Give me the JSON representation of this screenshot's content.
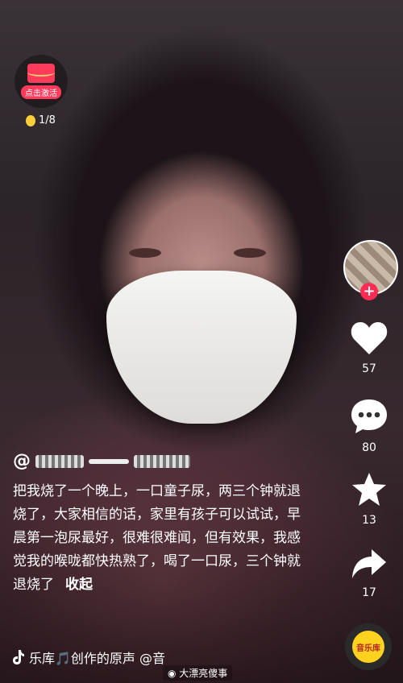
{
  "reward": {
    "label": "点击激活",
    "coins": "1/8"
  },
  "actions": {
    "likes": "57",
    "comments": "80",
    "favorites": "13",
    "shares": "17"
  },
  "post": {
    "username_prefix": "@",
    "caption": "把我烧了一个晚上，一口童子尿，两三个钟就退烧了，大家相信的话，家里有孩子可以试试，早晨第一泡尿最好，很难很难闻，但有效果，我感觉我的喉咙都快热熟了，喝了一口尿，三个钟就退烧了",
    "collapse": "收起"
  },
  "music": {
    "text": "乐库🎵创作的原声 @音",
    "badge": "音乐库"
  },
  "watermark": "大漂亮傻事"
}
